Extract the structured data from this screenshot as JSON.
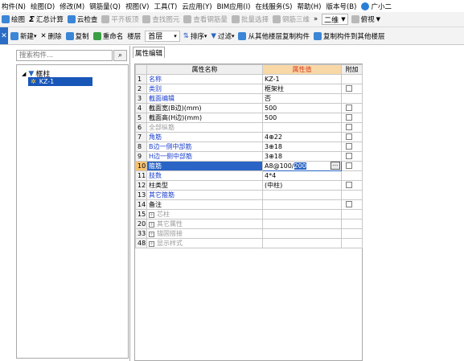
{
  "menu": [
    "构件(N)",
    "绘图(D)",
    "修改(M)",
    "钢筋量(Q)",
    "视图(V)",
    "工具(T)",
    "云应用(Y)",
    "BIM应用(I)",
    "在线服务(S)",
    "帮助(H)",
    "版本号(B)"
  ],
  "user": "广小二",
  "toolbar1": {
    "items": [
      {
        "label": "绘图",
        "enabled": true
      },
      {
        "label": "汇总计算",
        "enabled": true
      },
      {
        "label": "云检查",
        "enabled": true
      },
      {
        "label": "平齐板顶",
        "enabled": false
      },
      {
        "label": "查找图元",
        "enabled": false
      },
      {
        "label": "查看钢筋量",
        "enabled": false
      },
      {
        "label": "批量选择",
        "enabled": false
      },
      {
        "label": "钢筋三维",
        "enabled": false
      }
    ],
    "view_select": "二维",
    "view_button": "俯视"
  },
  "toolbar2": {
    "new": "新建",
    "delete": "删除",
    "copy": "复制",
    "rename": "重命名",
    "floor_label": "楼层",
    "floor_value": "首层",
    "sort": "排序",
    "filter": "过滤",
    "copy_from": "从其他楼层复制构件",
    "copy_to": "复制构件到其他楼层"
  },
  "left": {
    "search_placeholder": "搜索构件...",
    "tree_root": "框柱",
    "tree_child": "KZ-1"
  },
  "tab_label": "属性编辑",
  "grid": {
    "headers": {
      "name": "属性名称",
      "value": "属性值",
      "extra": "附加"
    },
    "rows": [
      {
        "no": "1",
        "name": "名称",
        "value": "KZ-1",
        "style": "blue",
        "checkbox": false
      },
      {
        "no": "2",
        "name": "类别",
        "value": "框架柱",
        "style": "blue",
        "checkbox": true
      },
      {
        "no": "3",
        "name": "截面编辑",
        "value": "否",
        "style": "blue",
        "checkbox": false
      },
      {
        "no": "4",
        "name": "截面宽(B边)(mm)",
        "value": "500",
        "style": "normal",
        "checkbox": true
      },
      {
        "no": "5",
        "name": "截面高(H边)(mm)",
        "value": "500",
        "style": "normal",
        "checkbox": true
      },
      {
        "no": "6",
        "name": "全部纵筋",
        "value": "",
        "style": "gray",
        "checkbox": true
      },
      {
        "no": "7",
        "name": "角筋",
        "value": "4\u001d22",
        "style": "blue",
        "checkbox": true
      },
      {
        "no": "8",
        "name": "B边一侧中部筋",
        "value": "3\u001d18",
        "style": "blue",
        "checkbox": true
      },
      {
        "no": "9",
        "name": "H边一侧中部筋",
        "value": "3\u001d18",
        "style": "blue",
        "checkbox": true
      },
      {
        "no": "10",
        "name": "箍筋",
        "value_prefix": "A8@100/",
        "value_selected": "200",
        "style": "selected",
        "checkbox": true
      },
      {
        "no": "11",
        "name": "肢数",
        "value": "4*4",
        "style": "blue",
        "checkbox": false
      },
      {
        "no": "12",
        "name": "柱类型",
        "value": "(中柱)",
        "style": "normal",
        "checkbox": true
      },
      {
        "no": "13",
        "name": "其它箍筋",
        "value": "",
        "style": "blue",
        "checkbox": false
      },
      {
        "no": "14",
        "name": "备注",
        "value": "",
        "style": "normal",
        "checkbox": true
      }
    ],
    "groups": [
      {
        "no": "15",
        "name": "芯柱"
      },
      {
        "no": "20",
        "name": "其它属性"
      },
      {
        "no": "33",
        "name": "锚固搭接"
      },
      {
        "no": "48",
        "name": "显示样式"
      }
    ]
  },
  "colors": {
    "accent_blue": "#2a64c5",
    "header_value_bg": "#f9d8a7",
    "header_value_text": "#d63a1d",
    "selected_row_number_bg": "#f7c36e"
  }
}
